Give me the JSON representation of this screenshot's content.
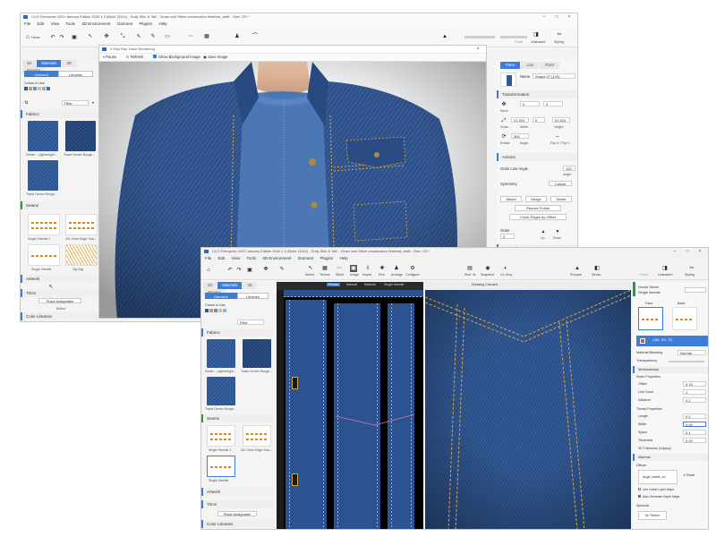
{
  "window_back": {
    "title": "CLO Enterprise 2020 January Edition 2020.1.2 (Build 11611) - Sully Slim & Tall! - Seam and Stitch construction Material_draft - Size: OS *",
    "menu": [
      "File",
      "Edit",
      "View",
      "Tools",
      "3D Environment",
      "Garment",
      "Plugins",
      "Help"
    ],
    "home_label": "Home",
    "right_toolbar": [
      "Fixed",
      "Unshaded",
      "Styling"
    ],
    "left_tabs": [
      "2D",
      "Materials",
      "3D",
      "Parame"
    ],
    "subtabs": [
      "Garment",
      "Libraries"
    ],
    "colors_in_use": "Colors in Use",
    "filter_label": "Filter",
    "fabrics_header": "Fabrics",
    "fabrics": [
      "Denim - Lightweight...",
      "Trade Denim Rough...",
      "Trade Denim Rough..."
    ],
    "seams_header": "Seams",
    "seams": [
      "Single Needle 2",
      "401 2mm Edge Sna...",
      "Single Needle",
      "Zig Zag"
    ],
    "artwork_header": "Artwork",
    "trims_header": "Trims",
    "place_assignable": "Place Assignable",
    "button_label": "Button",
    "color_libraries": "Color Libraries"
  },
  "render_window": {
    "title": "V-Ray Ray Trace Rendering",
    "toolbar": [
      "Pause",
      "Refresh",
      "Show Background Image",
      "Save Image"
    ]
  },
  "property_panel": {
    "tabs": [
      "Piece",
      "Line",
      "Point"
    ],
    "name_label": "Name",
    "name_value": "Shape 07 (123)",
    "transformation": "Transformation",
    "move_label": "Move",
    "move_x": "0",
    "move_y": "0",
    "scale_label": "Scale",
    "width_label": "Width",
    "height_label": "Height",
    "scale_value": "21.904",
    "width_value": "0",
    "height_value": "61.924",
    "rotate_label": "Rotate",
    "angle_label": "Angle",
    "angle_value": "360",
    "flip_label": "Flip H / Flip V",
    "actions": "Actions",
    "grain_label": "Grain Line Angle",
    "grain_value": "100",
    "grain_unit": "Angle",
    "symmetry": "Symmetry",
    "cancel": "Cancel",
    "attach": "Attach",
    "merge": "Merge",
    "divide": "Divide",
    "reduce_points": "Reduce Points",
    "clone_edges": "Clone Edges by Offset",
    "order_label": "Order",
    "order_value": "0",
    "up": "Up",
    "down": "Down",
    "materials": "Materials",
    "draping": "Draping Properties"
  },
  "window_front": {
    "title": "CLO Enterprise 2020 January Edition 2020.1.2 (Build 11611) - Sully Slim & Tall! - Seam and Stitch construction Material_draft - Size: OS *",
    "menu": [
      "File",
      "Edit",
      "View",
      "Tools",
      "3D Environment",
      "Garment",
      "Plugins",
      "Help"
    ],
    "tool_labels": [
      "Select",
      "Texture",
      "Stitch",
      "Image",
      "Import",
      "Pick",
      "Arrange",
      "Configure"
    ],
    "right_tools": [
      "Size: XL",
      "Snapshot",
      "UI: Grey",
      "Prepare",
      "Stress",
      "Fixed",
      "Unshaded",
      "Styling"
    ],
    "left_tabs": [
      "2D",
      "Materials",
      "3D",
      "Parame"
    ],
    "subtabs": [
      "Garment",
      "Libraries"
    ],
    "colors_in_use": "Colors in Use",
    "filter_label": "Filter",
    "fabrics_header": "Fabrics",
    "fabrics": [
      "Denim - Lightweight...",
      "Trade Denim Rough...",
      "Trade Denim Rough..."
    ],
    "seams_header": "Seams",
    "seams": [
      "Single Needle 2",
      "401 2mm Edge Sna...",
      "Single Needle"
    ],
    "artwork_header": "Artwork",
    "trims_header": "Trims",
    "place_assignable": "Place Assignable",
    "color_libraries": "Color Libraries",
    "view2d_toolbar": [
      "Pieces",
      "Internal",
      "Material",
      "Single Needle"
    ],
    "view3d_toolbar": "Dressing Casual",
    "seam_panel": {
      "name": "Vector Seam",
      "sub": "Single Needle",
      "face": "Face",
      "back": "Back",
      "color_hex": "(188, 101, 72)",
      "blending_label": "Material Blending",
      "blending_value": "Normal",
      "transparency_label": "Transparency",
      "workmanship": "Workmanship",
      "seam_properties": "Seam Properties",
      "offset_label": "Offset",
      "offset_value": "0.15",
      "line_count_label": "Line Count",
      "line_count_value": "1",
      "distance_label": "Distance",
      "distance_value": "0.2",
      "thread_properties": "Thread Properties",
      "length_label": "Length",
      "width_label": "Width",
      "space_label": "Space",
      "thickness_label": "Thickness",
      "length_value": "0.4",
      "width_value": "0.03",
      "space_value": "0.1",
      "thickness_value": "0.03",
      "thickness3d_label": "3D Thickness (Legacy)",
      "material": "Material",
      "diffuse": "Diffuse",
      "diffuse_file": "single_needle_col",
      "reset": "Reset",
      "use_linear": "Use Linear Layer Maps",
      "auto_depth": "Auto Generate Depth Maps",
      "specular": "Specular",
      "no_texture": "No Texture"
    }
  },
  "colors": {
    "accent": "#3d7dd6",
    "denim": "#2f5a9a",
    "stitch": "#e0a63a"
  }
}
